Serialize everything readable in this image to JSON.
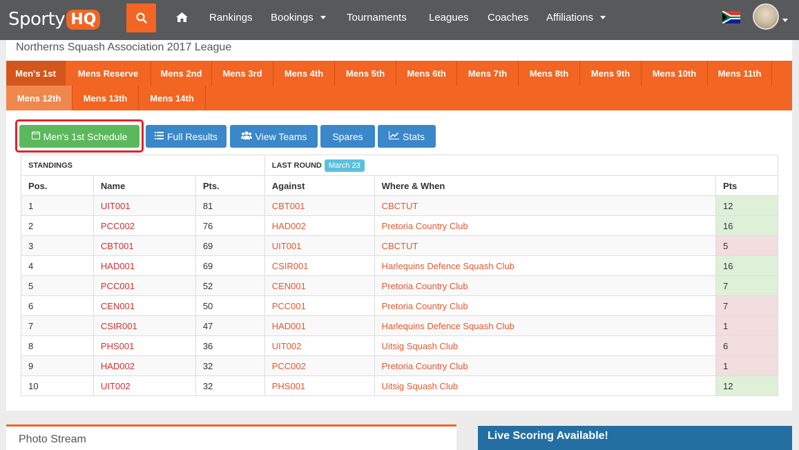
{
  "nav": {
    "logo_text": "Sporty",
    "logo_badge": "HQ",
    "items": [
      "Rankings",
      "Bookings",
      "Tournaments",
      "Leagues",
      "Coaches",
      "Affiliations"
    ]
  },
  "league_title": "Northerns Squash Association 2017 League",
  "tabs": [
    "Men's 1st",
    "Mens Reserve",
    "Mens 2nd",
    "Mens 3rd",
    "Mens 4th",
    "Mens 5th",
    "Mens 6th",
    "Mens 7th",
    "Mens 8th",
    "Mens 9th",
    "Mens 10th",
    "Mens 11th",
    "Mens 12th",
    "Mens 13th",
    "Mens 14th"
  ],
  "buttons": {
    "schedule": "Men's 1st Schedule",
    "full_results": "Full Results",
    "view_teams": "View Teams",
    "spares": "Spares",
    "stats": "Stats"
  },
  "table": {
    "standings_label": "STANDINGS",
    "last_round_label": "LAST ROUND",
    "last_round_date": "March 23",
    "headers": [
      "Pos.",
      "Name",
      "Pts.",
      "Against",
      "Where & When",
      "Pts"
    ],
    "rows": [
      [
        "1",
        "UIT001",
        "81",
        "CBT001",
        "CBCTUT",
        "12"
      ],
      [
        "2",
        "PCC002",
        "76",
        "HAD002",
        "Pretoria Country Club",
        "16"
      ],
      [
        "3",
        "CBT001",
        "69",
        "UIT001",
        "CBCTUT",
        "5"
      ],
      [
        "4",
        "HAD001",
        "69",
        "CSIR001",
        "Harlequins Defence Squash Club",
        "16"
      ],
      [
        "5",
        "PCC001",
        "52",
        "CEN001",
        "Pretoria Country Club",
        "7"
      ],
      [
        "6",
        "CEN001",
        "50",
        "PCC001",
        "Pretoria Country Club",
        "7"
      ],
      [
        "7",
        "CSIR001",
        "47",
        "HAD001",
        "Harlequins Defence Squash Club",
        "1"
      ],
      [
        "8",
        "PHS001",
        "36",
        "UIT002",
        "Uitsig Squash Club",
        "6"
      ],
      [
        "9",
        "HAD002",
        "32",
        "PCC002",
        "Pretoria Country Club",
        "1"
      ],
      [
        "10",
        "UIT002",
        "32",
        "PHS001",
        "Uitsig Squash Club",
        "12"
      ]
    ],
    "pts_status": [
      "win",
      "win",
      "loss",
      "win",
      "win",
      "loss",
      "loss",
      "loss",
      "loss",
      "win"
    ]
  },
  "photo_stream": "Photo Stream",
  "live_scoring": "Live Scoring Available!",
  "colors": {
    "brand_orange": "#f26522",
    "nav_gray": "#58595b",
    "btn_blue": "#3a87c9",
    "btn_green": "#5cb85c",
    "win_bg": "#dff0d8",
    "loss_bg": "#f2dede"
  }
}
